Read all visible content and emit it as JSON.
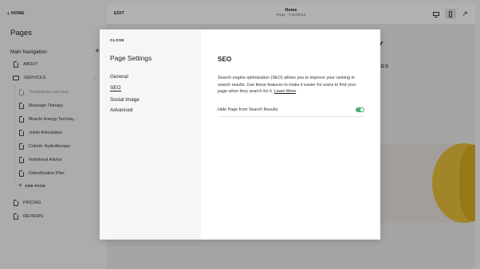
{
  "sidebar": {
    "home_label": "HOME",
    "title": "Pages",
    "nav_heading": "Main Navigation",
    "items": [
      {
        "label": "ABOUT"
      },
      {
        "label": "SERVICES"
      },
      {
        "label": "Treatments overview"
      },
      {
        "label": "Massage Therapy"
      },
      {
        "label": "Muscle Energy Techniq..."
      },
      {
        "label": "Joints Articulation"
      },
      {
        "label": "Colonic Hydrotherapy"
      },
      {
        "label": "Nutritional Advice"
      },
      {
        "label": "Detoxification Plan"
      },
      {
        "label": "PRICING"
      },
      {
        "label": "REVIEWS"
      }
    ],
    "add_page_label": "ADD PAGE"
  },
  "topbar": {
    "edit_label": "EDIT",
    "page_title": "Home",
    "page_status": "Page · Published"
  },
  "preview": {
    "headline_fragment": "Y",
    "subtitle_fragment": "NGS"
  },
  "modal": {
    "close_label": "CLOSE",
    "title": "Page Settings",
    "tabs": [
      {
        "label": "General"
      },
      {
        "label": "SEO"
      },
      {
        "label": "Social Image"
      },
      {
        "label": "Advanced"
      }
    ],
    "active_tab": "SEO",
    "seo": {
      "heading": "SEO",
      "description": "Search engine optimization (SEO) allows you to improve your ranking in search results. Use these features to make it easier for users to find your page when they search for it.",
      "learn_more": "Learn More",
      "toggle_label": "Hide Page from Search Results",
      "toggle_on": true
    }
  },
  "colors": {
    "toggle_on": "#4caf7a",
    "overlay": "rgba(0,0,0,0.30)"
  },
  "icons": [
    "chevron-left-icon",
    "plus-icon",
    "page-icon",
    "folder-icon",
    "desktop-icon",
    "mobile-icon",
    "expand-icon"
  ]
}
